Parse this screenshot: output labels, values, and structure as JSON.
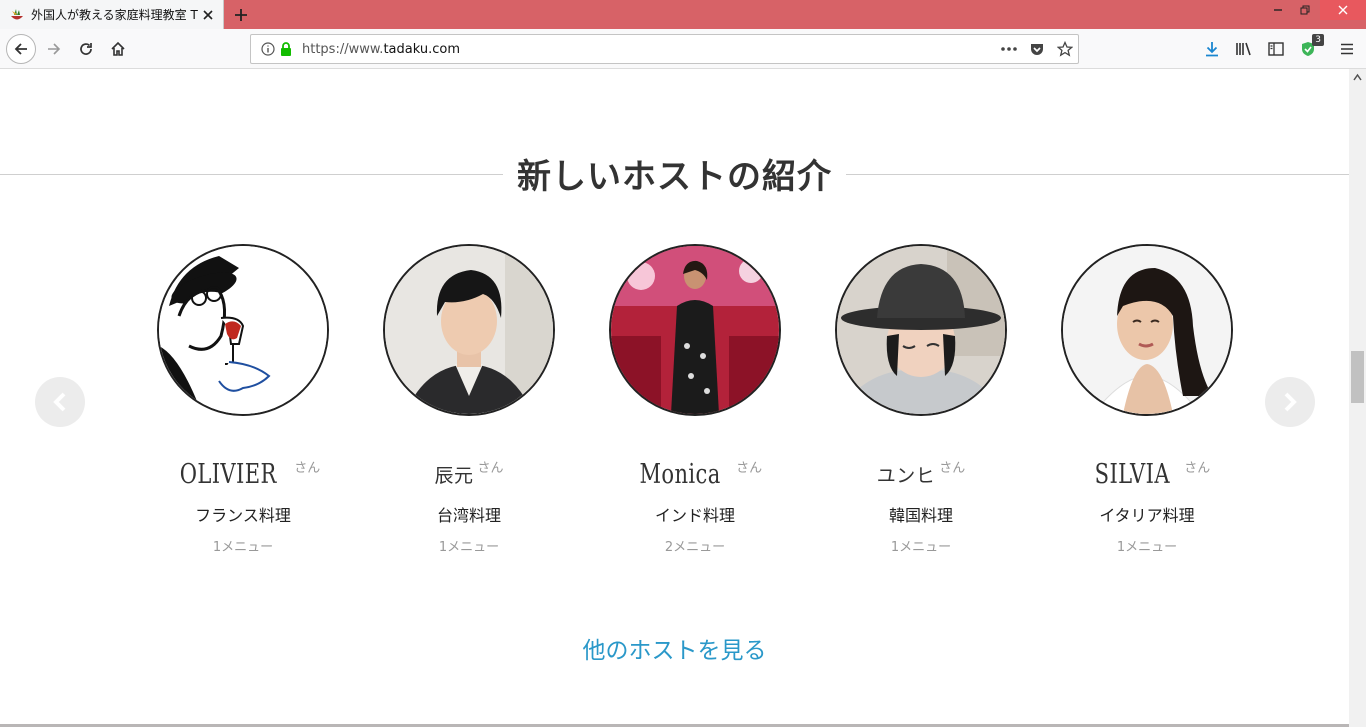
{
  "browser": {
    "tab_title": "外国人が教える家庭料理教室 T",
    "url_prefix": "https://www.",
    "url_domain": "tadaku.com",
    "extension_badge": "3"
  },
  "section": {
    "title": "新しいホストの紹介",
    "more_link": "他のホストを見る"
  },
  "hosts": [
    {
      "name": "Olivier",
      "honorific": "さん",
      "cuisine": "フランス料理",
      "menus": "1メニュー"
    },
    {
      "name": "辰元",
      "honorific": "さん",
      "cuisine": "台湾料理",
      "menus": "1メニュー"
    },
    {
      "name": "Monica",
      "honorific": "さん",
      "cuisine": "インド料理",
      "menus": "2メニュー"
    },
    {
      "name": "ユンヒ",
      "honorific": "さん",
      "cuisine": "韓国料理",
      "menus": "1メニュー"
    },
    {
      "name": "Silvia",
      "honorific": "さん",
      "cuisine": "イタリア料理",
      "menus": "1メニュー"
    }
  ],
  "colors": {
    "titlebar": "#d76267",
    "link": "#2a98c9",
    "accent_download": "#1a86d0"
  }
}
